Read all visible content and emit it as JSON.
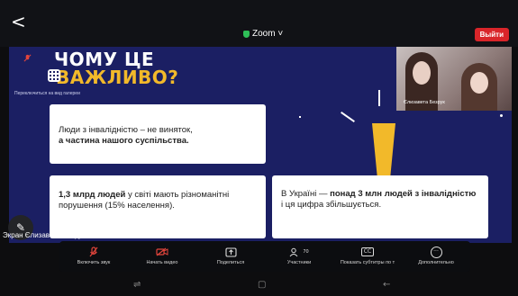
{
  "header": {
    "back_glyph": "<",
    "app_title": "Zoom ˅",
    "leave_label": "Выйти"
  },
  "slide": {
    "title_line1": "ЧОМУ ЦЕ",
    "title_line2_accent": "В",
    "title_line2": "АЖЛИВО?",
    "gallery_hint": "Переключиться на вид галереи",
    "card1_normal": "Люди з інвалідністю – не виняток,",
    "card1_bold": "а частина нашого суспільства.",
    "card2_bold": "1,3 млрд людей",
    "card2_rest": "у світі мають різноманітні порушення (15% населення).",
    "card3_start": "В Україні —",
    "card3_bold": "понад 3 млн людей з інвалідністю",
    "card3_end": "і ця цифра збільшується."
  },
  "video": {
    "participant_name": "Єлизавета Безрук"
  },
  "share": {
    "label": "Экран Єлизавета Безрук"
  },
  "toolbar": {
    "items": [
      {
        "label": "Включить звук",
        "icon": "mic-off-icon"
      },
      {
        "label": "Начать видео",
        "icon": "video-off-icon"
      },
      {
        "label": "Поделиться",
        "icon": "share-icon"
      },
      {
        "label": "Участники",
        "icon": "participants-icon",
        "count": "70"
      },
      {
        "label": "Показать субтитры по т",
        "icon": "captions-icon",
        "glyph": "CC"
      },
      {
        "label": "Дополнительно",
        "icon": "more-icon",
        "glyph": "···"
      }
    ]
  },
  "colors": {
    "slide_bg": "#1b1f63",
    "accent_yellow": "#f2b92a",
    "leave_red": "#d9252a",
    "secure_green": "#2fbf58"
  }
}
